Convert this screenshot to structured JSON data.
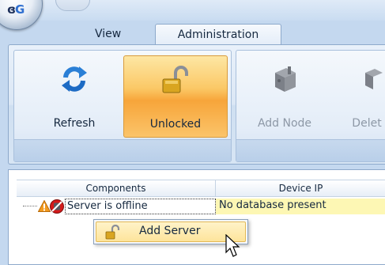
{
  "ribbon": {
    "tabs": [
      {
        "label": "View"
      },
      {
        "label": "Administration",
        "selected": true
      }
    ],
    "buttons": {
      "refresh": "Refresh",
      "unlocked": "Unlocked",
      "add_node": "Add Node",
      "delete": "Delet"
    }
  },
  "grid": {
    "columns": [
      "Components",
      "Device IP"
    ],
    "rows": [
      {
        "component": "Server is offline",
        "device_ip": "No database present"
      }
    ]
  },
  "context_menu": {
    "items": [
      {
        "label": "Add Server"
      }
    ]
  },
  "colors": {
    "accent": "#f7a53a",
    "ribbon_bg": "#dbe7f5",
    "highlight_cell": "#fdf7b4"
  },
  "icons": {
    "app_orb": "app-orb-icon",
    "refresh": "refresh-icon",
    "unlocked": "open-padlock-icon",
    "add_node": "server-node-icon",
    "warning": "warning-icon",
    "server_offline": "server-offline-icon",
    "cursor": "mouse-pointer-icon"
  }
}
